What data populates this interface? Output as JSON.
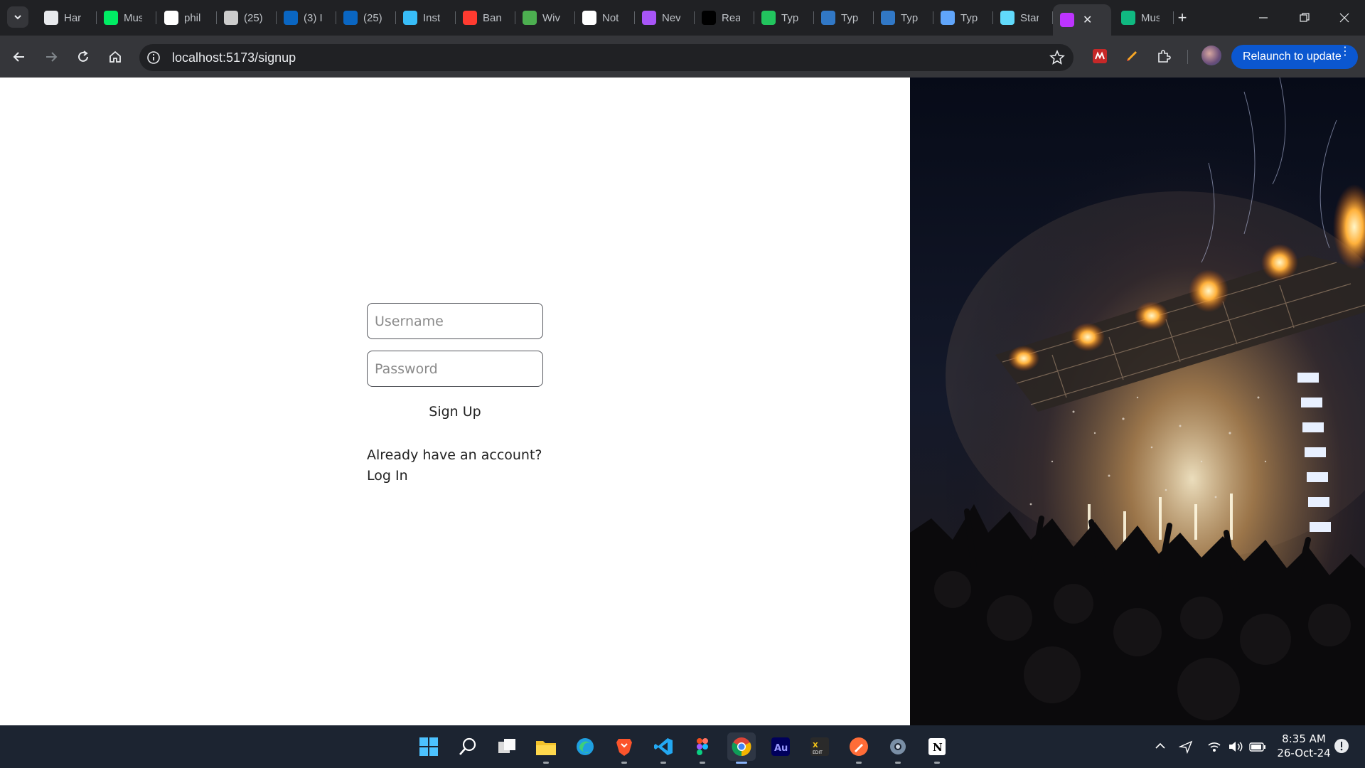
{
  "browser": {
    "tabs": [
      {
        "label": "Har",
        "icon": "gear-logo-icon",
        "color": "#e8eaed"
      },
      {
        "label": "Mus",
        "icon": "leaf-icon",
        "color": "#00ed64"
      },
      {
        "label": "phil",
        "icon": "github-icon",
        "color": "#ffffff"
      },
      {
        "label": "(25)",
        "icon": "globe-icon",
        "color": "#cccccc"
      },
      {
        "label": "(3) I",
        "icon": "linkedin-icon",
        "color": "#0a66c2"
      },
      {
        "label": "(25)",
        "icon": "linkedin-icon",
        "color": "#0a66c2"
      },
      {
        "label": "Inst",
        "icon": "tailwind-icon",
        "color": "#38bdf8"
      },
      {
        "label": "Ban",
        "icon": "record-icon",
        "color": "#ff3b30"
      },
      {
        "label": "Wiv",
        "icon": "w-logo-icon",
        "color": "#4caf50"
      },
      {
        "label": "Not",
        "icon": "notion-icon",
        "color": "#ffffff"
      },
      {
        "label": "Nev",
        "icon": "chat-bubble-icon",
        "color": "#a855f7"
      },
      {
        "label": "Rea",
        "icon": "dev-logo-icon",
        "color": "#000000"
      },
      {
        "label": "Typ",
        "icon": "w-logo-icon",
        "color": "#22c55e"
      },
      {
        "label": "Typ",
        "icon": "typescript-icon",
        "color": "#3178c6"
      },
      {
        "label": "Typ",
        "icon": "typescript-icon",
        "color": "#3178c6"
      },
      {
        "label": "Typ",
        "icon": "cloud-icon",
        "color": "#60a5fa"
      },
      {
        "label": "Star",
        "icon": "react-icon",
        "color": "#61dafb"
      },
      {
        "label": "",
        "icon": "vite-icon",
        "color": "#bd34fe",
        "active": true
      },
      {
        "label": "Mus",
        "icon": "p-logo-icon",
        "color": "#10b981"
      }
    ],
    "url": "localhost:5173/signup",
    "relaunch_label": "Relaunch to update"
  },
  "signup": {
    "username_placeholder": "Username",
    "password_placeholder": "Password",
    "submit_label": "Sign Up",
    "already_text": "Already have an account?",
    "login_label": "Log In"
  },
  "taskbar": {
    "apps": [
      "windows-start",
      "search",
      "task-view",
      "file-explorer",
      "edge",
      "brave",
      "vscode",
      "figma",
      "chrome",
      "audition",
      "xedit",
      "postman",
      "settings",
      "notion"
    ],
    "time": "8:35 AM",
    "date": "26-Oct-24"
  }
}
